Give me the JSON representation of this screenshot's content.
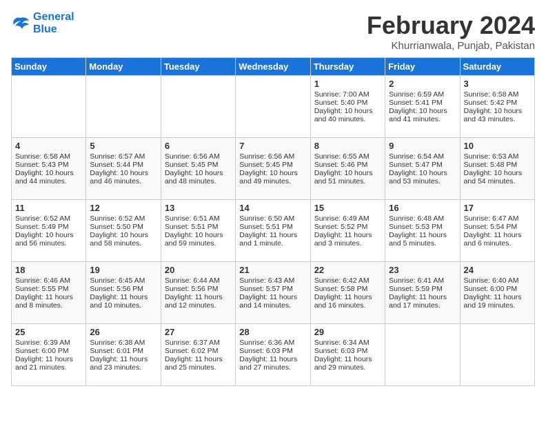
{
  "header": {
    "logo_line1": "General",
    "logo_line2": "Blue",
    "title": "February 2024",
    "subtitle": "Khurrianwala, Punjab, Pakistan"
  },
  "days_of_week": [
    "Sunday",
    "Monday",
    "Tuesday",
    "Wednesday",
    "Thursday",
    "Friday",
    "Saturday"
  ],
  "weeks": [
    [
      {
        "num": "",
        "info": ""
      },
      {
        "num": "",
        "info": ""
      },
      {
        "num": "",
        "info": ""
      },
      {
        "num": "",
        "info": ""
      },
      {
        "num": "1",
        "info": "Sunrise: 7:00 AM\nSunset: 5:40 PM\nDaylight: 10 hours\nand 40 minutes."
      },
      {
        "num": "2",
        "info": "Sunrise: 6:59 AM\nSunset: 5:41 PM\nDaylight: 10 hours\nand 41 minutes."
      },
      {
        "num": "3",
        "info": "Sunrise: 6:58 AM\nSunset: 5:42 PM\nDaylight: 10 hours\nand 43 minutes."
      }
    ],
    [
      {
        "num": "4",
        "info": "Sunrise: 6:58 AM\nSunset: 5:43 PM\nDaylight: 10 hours\nand 44 minutes."
      },
      {
        "num": "5",
        "info": "Sunrise: 6:57 AM\nSunset: 5:44 PM\nDaylight: 10 hours\nand 46 minutes."
      },
      {
        "num": "6",
        "info": "Sunrise: 6:56 AM\nSunset: 5:45 PM\nDaylight: 10 hours\nand 48 minutes."
      },
      {
        "num": "7",
        "info": "Sunrise: 6:56 AM\nSunset: 5:45 PM\nDaylight: 10 hours\nand 49 minutes."
      },
      {
        "num": "8",
        "info": "Sunrise: 6:55 AM\nSunset: 5:46 PM\nDaylight: 10 hours\nand 51 minutes."
      },
      {
        "num": "9",
        "info": "Sunrise: 6:54 AM\nSunset: 5:47 PM\nDaylight: 10 hours\nand 53 minutes."
      },
      {
        "num": "10",
        "info": "Sunrise: 6:53 AM\nSunset: 5:48 PM\nDaylight: 10 hours\nand 54 minutes."
      }
    ],
    [
      {
        "num": "11",
        "info": "Sunrise: 6:52 AM\nSunset: 5:49 PM\nDaylight: 10 hours\nand 56 minutes."
      },
      {
        "num": "12",
        "info": "Sunrise: 6:52 AM\nSunset: 5:50 PM\nDaylight: 10 hours\nand 58 minutes."
      },
      {
        "num": "13",
        "info": "Sunrise: 6:51 AM\nSunset: 5:51 PM\nDaylight: 10 hours\nand 59 minutes."
      },
      {
        "num": "14",
        "info": "Sunrise: 6:50 AM\nSunset: 5:51 PM\nDaylight: 11 hours\nand 1 minute."
      },
      {
        "num": "15",
        "info": "Sunrise: 6:49 AM\nSunset: 5:52 PM\nDaylight: 11 hours\nand 3 minutes."
      },
      {
        "num": "16",
        "info": "Sunrise: 6:48 AM\nSunset: 5:53 PM\nDaylight: 11 hours\nand 5 minutes."
      },
      {
        "num": "17",
        "info": "Sunrise: 6:47 AM\nSunset: 5:54 PM\nDaylight: 11 hours\nand 6 minutes."
      }
    ],
    [
      {
        "num": "18",
        "info": "Sunrise: 6:46 AM\nSunset: 5:55 PM\nDaylight: 11 hours\nand 8 minutes."
      },
      {
        "num": "19",
        "info": "Sunrise: 6:45 AM\nSunset: 5:56 PM\nDaylight: 11 hours\nand 10 minutes."
      },
      {
        "num": "20",
        "info": "Sunrise: 6:44 AM\nSunset: 5:56 PM\nDaylight: 11 hours\nand 12 minutes."
      },
      {
        "num": "21",
        "info": "Sunrise: 6:43 AM\nSunset: 5:57 PM\nDaylight: 11 hours\nand 14 minutes."
      },
      {
        "num": "22",
        "info": "Sunrise: 6:42 AM\nSunset: 5:58 PM\nDaylight: 11 hours\nand 16 minutes."
      },
      {
        "num": "23",
        "info": "Sunrise: 6:41 AM\nSunset: 5:59 PM\nDaylight: 11 hours\nand 17 minutes."
      },
      {
        "num": "24",
        "info": "Sunrise: 6:40 AM\nSunset: 6:00 PM\nDaylight: 11 hours\nand 19 minutes."
      }
    ],
    [
      {
        "num": "25",
        "info": "Sunrise: 6:39 AM\nSunset: 6:00 PM\nDaylight: 11 hours\nand 21 minutes."
      },
      {
        "num": "26",
        "info": "Sunrise: 6:38 AM\nSunset: 6:01 PM\nDaylight: 11 hours\nand 23 minutes."
      },
      {
        "num": "27",
        "info": "Sunrise: 6:37 AM\nSunset: 6:02 PM\nDaylight: 11 hours\nand 25 minutes."
      },
      {
        "num": "28",
        "info": "Sunrise: 6:36 AM\nSunset: 6:03 PM\nDaylight: 11 hours\nand 27 minutes."
      },
      {
        "num": "29",
        "info": "Sunrise: 6:34 AM\nSunset: 6:03 PM\nDaylight: 11 hours\nand 29 minutes."
      },
      {
        "num": "",
        "info": ""
      },
      {
        "num": "",
        "info": ""
      }
    ]
  ]
}
